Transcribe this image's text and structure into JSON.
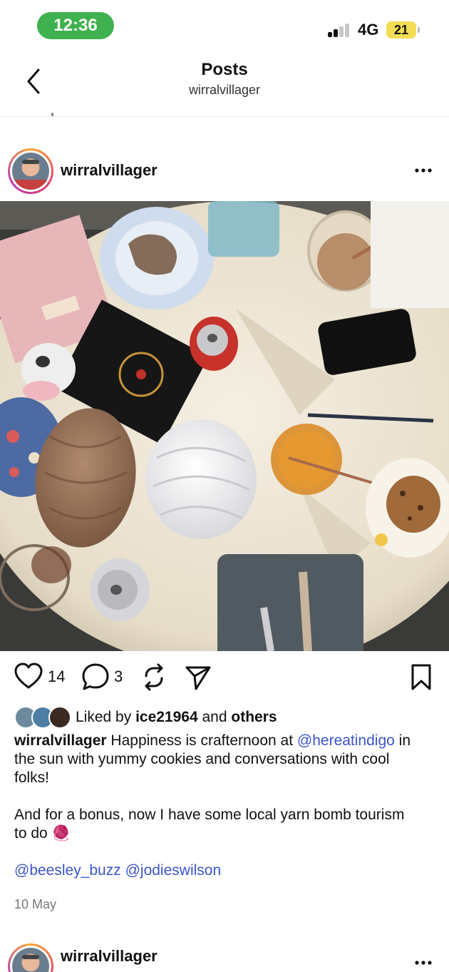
{
  "status": {
    "time": "12:36",
    "network": "4G",
    "battery": "21"
  },
  "nav": {
    "title": "Posts",
    "subtitle": "wirralvillager"
  },
  "post": {
    "username": "wirralvillager",
    "likes_count": "14",
    "comments_count": "3",
    "liked_by_prefix": "Liked by",
    "liked_by_user": "ice21964",
    "liked_by_and": "and",
    "liked_by_others": "others",
    "caption_user": "wirralvillager",
    "caption_line1": "Happiness is crafternoon at",
    "caption_mention1": "@hereatindigo",
    "caption_line2": "in the sun with yummy cookies and conversations with cool folks!",
    "caption_line3": "And for a bonus, now I have some local yarn bomb tourism to do",
    "caption_emoji": "🧶",
    "mention_a": "@beesley_buzz",
    "mention_b": "@jodieswilson",
    "date": "10 May"
  },
  "next_post": {
    "username": "wirralvillager"
  },
  "colors": {
    "accent_link": "#3b55c9",
    "status_pill": "#3fb14e",
    "battery": "#f3dd55"
  },
  "icons": [
    "chevron-left-icon",
    "more-dots-icon",
    "heart-icon",
    "comment-icon",
    "repost-icon",
    "share-icon",
    "bookmark-icon",
    "yarn-emoji"
  ]
}
